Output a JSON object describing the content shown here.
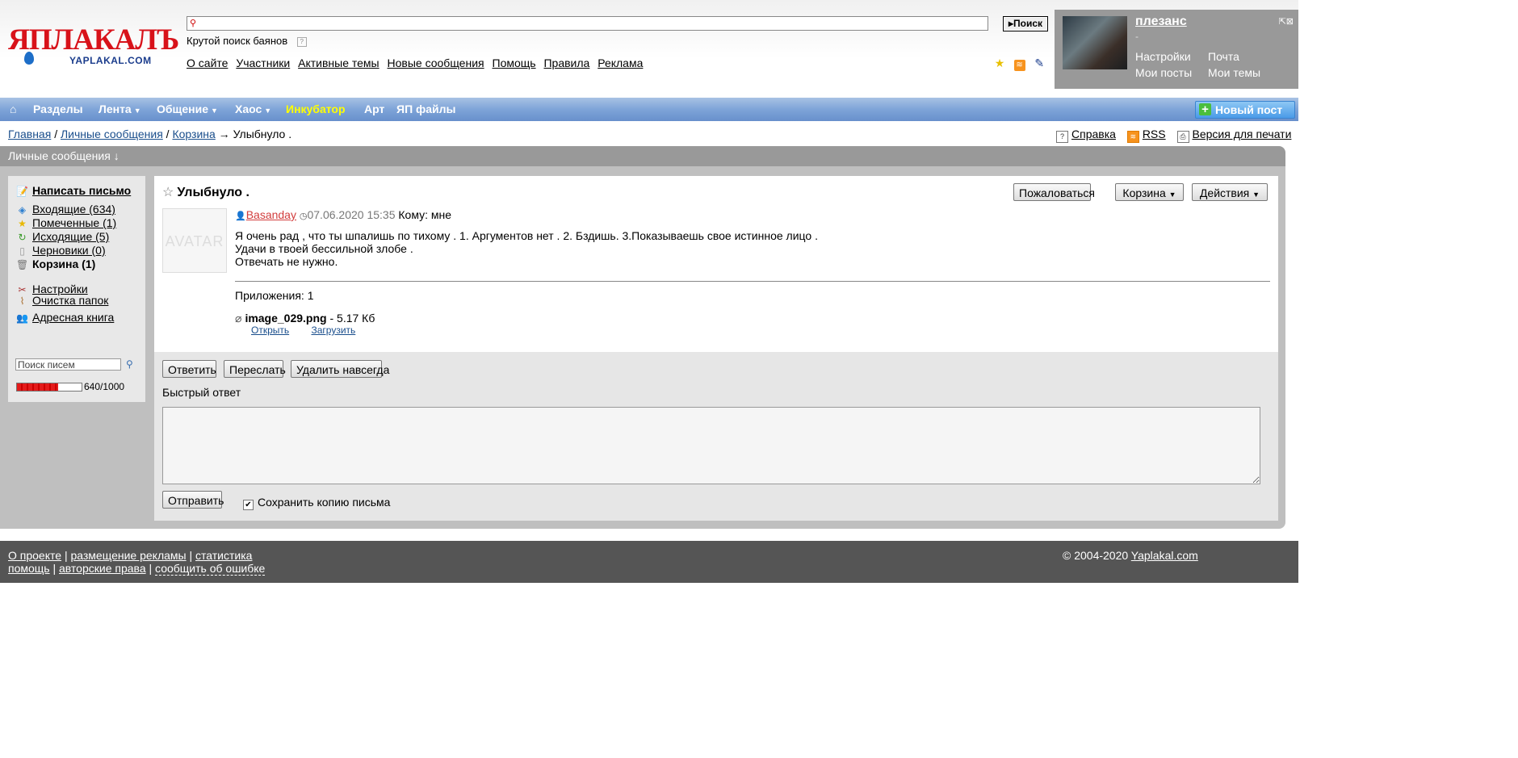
{
  "logo": {
    "text": "ЯПЛАКАЛЪ",
    "subtext": "YAPLAKAL.COM"
  },
  "search": {
    "button_label": "Поиск",
    "hint": "Крутой поиск баянов",
    "hint_icon": "?"
  },
  "topnav": [
    "О сайте",
    "Участники",
    "Активные темы",
    "Новые сообщения",
    "Помощь",
    "Правила",
    "Реклама"
  ],
  "user": {
    "name": "плезанс",
    "status": "-",
    "links": {
      "settings": "Настройки",
      "mail": "Почта",
      "my_posts": "Мои посты",
      "my_topics": "Мои темы"
    }
  },
  "menu": {
    "home": "⌂",
    "items": [
      "Разделы",
      "Лента",
      "Общение",
      "Хаос",
      "Инкубатор",
      "Арт",
      "ЯП файлы"
    ],
    "new_post": "Новый пост"
  },
  "breadcrumb": {
    "home": "Главная",
    "pm": "Личные сообщения",
    "trash": "Корзина",
    "arrow": "→",
    "current": "Улыбнуло ."
  },
  "tools": {
    "help": "Справка",
    "rss": "RSS",
    "print": "Версия для печати"
  },
  "section_title": "Личные сообщения ↓",
  "sidebar": {
    "compose": "Написать письмо",
    "folders": [
      {
        "label": "Входящие (634)",
        "icon": "inbox-icon"
      },
      {
        "label": "Помеченные (1)",
        "icon": "star-icon"
      },
      {
        "label": "Исходящие (5)",
        "icon": "outbox-icon"
      },
      {
        "label": "Черновики (0)",
        "icon": "draft-icon"
      },
      {
        "label": "Корзина (1)",
        "icon": "trash-icon"
      }
    ],
    "settings": "Настройки",
    "clean": "Очистка папок",
    "addressbook": "Адресная книга",
    "search_value": "Поиск писем",
    "quota_text": "640/1000",
    "quota_fraction": 0.64
  },
  "message": {
    "title": "Улыбнуло .",
    "buttons": {
      "report": "Пожаловаться",
      "trash": "Корзина",
      "actions": "Действия"
    },
    "avatar_text": "AVATAR",
    "author": "Basanday",
    "date": "07.06.2020 15:35",
    "to": "Кому: мне",
    "body": [
      "Я очень рад , что ты шпалишь по тихому . 1. Аргументов нет . 2. Бздишь. 3.Показываешь свое истинное лицо .",
      "Удачи в твоей бессильной злобе .",
      "Отвечать не нужно."
    ],
    "attachments_label": "Приложения: 1",
    "file_name": "image_029.png",
    "file_size": " - 5.17 Кб",
    "open": "Открыть",
    "download": "Загрузить"
  },
  "reply": {
    "reply_btn": "Ответить",
    "forward_btn": "Переслать",
    "delete_btn": "Удалить навсегда",
    "quick_label": "Быстрый ответ",
    "textarea_value": "",
    "send_btn": "Отправить",
    "save_copy": "Сохранить копию письма"
  },
  "footer": {
    "about": "О проекте",
    "ads": "размещение рекламы",
    "stats": "статистика",
    "help": "помощь",
    "copyright_rights": "авторские права",
    "report_error": "сообщить об ошибке",
    "sep": "|",
    "copyright": "© 2004-2020",
    "site": "Yaplakal.com"
  }
}
